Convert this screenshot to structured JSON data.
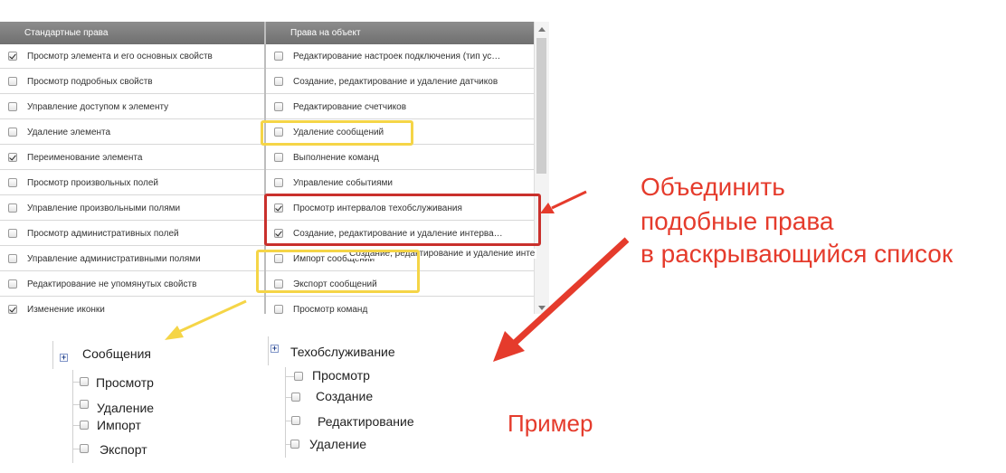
{
  "grid": {
    "left_header": "Стандартные права",
    "right_header": "Права на объект",
    "left_rows": [
      {
        "label": "Просмотр элемента и его основных свойств",
        "checked": true
      },
      {
        "label": "Просмотр подробных свойств",
        "checked": false
      },
      {
        "label": "Управление доступом к элементу",
        "checked": false
      },
      {
        "label": "Удаление элемента",
        "checked": false
      },
      {
        "label": "Переименование элемента",
        "checked": true
      },
      {
        "label": "Просмотр произвольных полей",
        "checked": false
      },
      {
        "label": "Управление произвольными полями",
        "checked": false
      },
      {
        "label": "Просмотр административных полей",
        "checked": false
      },
      {
        "label": "Управление административными полями",
        "checked": false
      },
      {
        "label": "Редактирование не упомянутых свойств",
        "checked": false
      },
      {
        "label": "Изменение иконки",
        "checked": true
      }
    ],
    "right_rows": [
      {
        "label": "Редактирование настроек подключения (тип ус…",
        "checked": false
      },
      {
        "label": "Создание, редактирование и удаление датчиков",
        "checked": false
      },
      {
        "label": "Редактирование счетчиков",
        "checked": false
      },
      {
        "label": "Удаление сообщений",
        "checked": false
      },
      {
        "label": "Выполнение команд",
        "checked": false
      },
      {
        "label": "Управление событиями",
        "checked": false
      },
      {
        "label": "Просмотр интервалов техобслуживания",
        "checked": true
      },
      {
        "label": "Создание, редактирование и удаление интерва…",
        "checked": true
      },
      {
        "label": "Импорт сообщений",
        "checked": false
      },
      {
        "label": "Экспорт сообщений",
        "checked": false
      },
      {
        "label": "Просмотр команд",
        "checked": false
      }
    ],
    "tooltip": "Создание, редактирование и удаление инте"
  },
  "tree_messages": {
    "title": "Сообщения",
    "items": [
      "Просмотр",
      "Удаление",
      "Импорт",
      "Экспорт"
    ]
  },
  "tree_maintenance": {
    "title": "Техобслуживание",
    "items": [
      "Просмотр",
      "Создание",
      "Редактирование",
      "Удаление"
    ]
  },
  "annotation": {
    "line1": "Объединить",
    "line2": "подобные права",
    "line3": "в раскрывающийся список",
    "example": "Пример"
  },
  "colors": {
    "red": "#e53b2c",
    "yellow": "#f5d547",
    "dark_red_box": "#c9302c",
    "header_bg": "#7a7a7a"
  }
}
